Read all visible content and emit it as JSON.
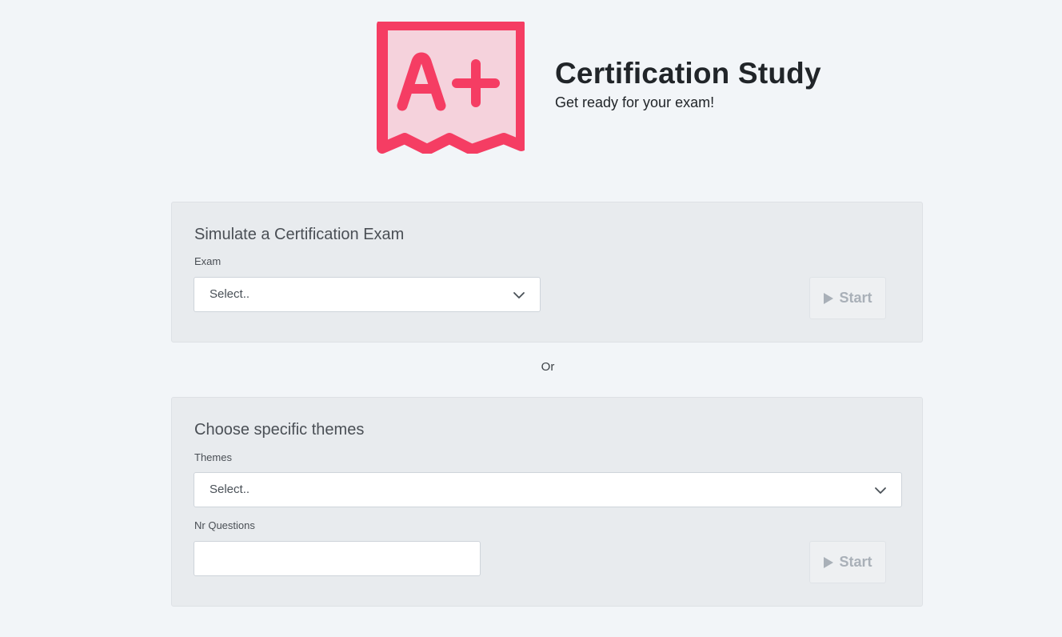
{
  "header": {
    "title": "Certification Study",
    "subtitle": "Get ready for your exam!",
    "logo_text": "A+",
    "logo_colors": {
      "stroke": "#f53d63",
      "fill": "#f5d2dc"
    }
  },
  "exam_section": {
    "title": "Simulate a Certification Exam",
    "exam_label": "Exam",
    "exam_select_value": "Select..",
    "start_label": "Start"
  },
  "separator_text": "Or",
  "themes_section": {
    "title": "Choose specific themes",
    "themes_label": "Themes",
    "themes_select_value": "Select..",
    "nr_questions_label": "Nr Questions",
    "nr_questions_value": "",
    "start_label": "Start"
  },
  "icons": {
    "select_arrow": "chevron-down-icon",
    "start_button": "play-icon"
  },
  "colors": {
    "background": "#f2f5f8",
    "card_background": "#e8ebee",
    "disabled_button_text": "#a9b0b8"
  }
}
